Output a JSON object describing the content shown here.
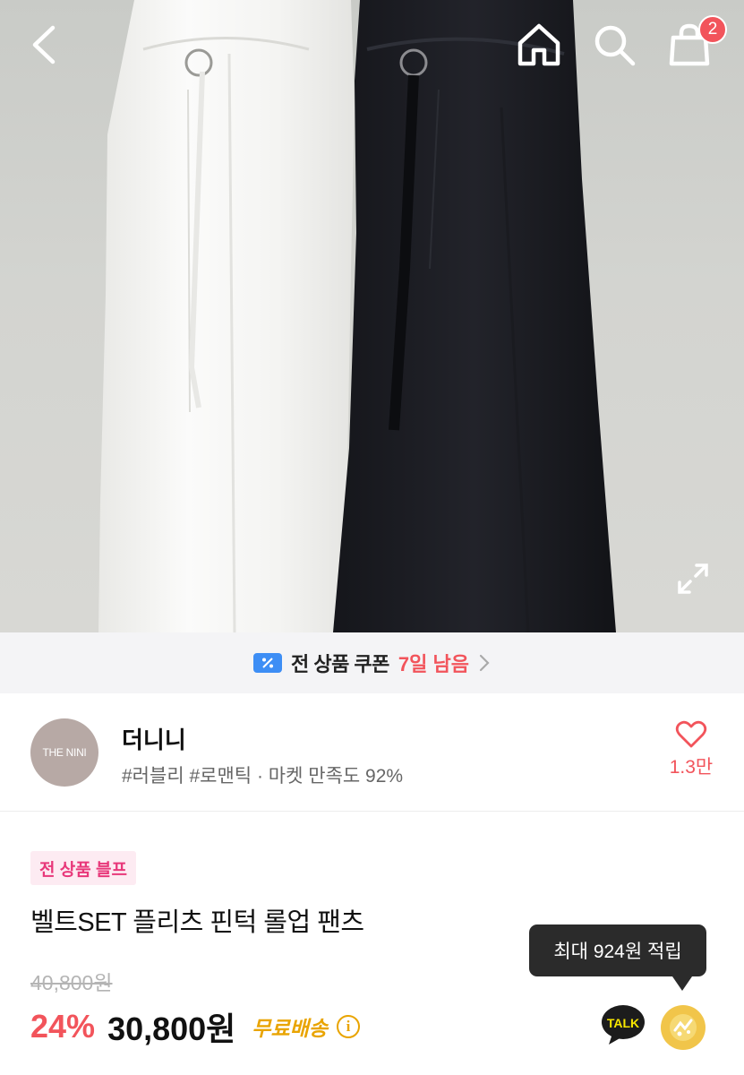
{
  "header": {
    "back_icon": "chevron-left-icon",
    "home_icon": "home-icon",
    "search_icon": "search-icon",
    "cart_icon": "shopping-bag-icon",
    "cart_count": "2",
    "expand_icon": "expand-icon"
  },
  "coupon_banner": {
    "icon": "coupon-icon",
    "text": "전 상품 쿠폰",
    "days_left": "7일 남음",
    "arrow_icon": "chevron-right-icon"
  },
  "store": {
    "logo_text": "THE NINI",
    "name": "더니니",
    "tags": "#러블리 #로맨틱 · 마켓 만족도 92%",
    "like_icon": "heart-outline-icon",
    "like_count": "1.3만"
  },
  "product": {
    "promo_badge": "전 상품 블프",
    "title": "벨트SET 플리츠 핀턱 롤업 팬츠",
    "original_price": "40,800원",
    "discount": "24%",
    "sale_price": "30,800원",
    "free_shipping": "무료배송",
    "info_icon": "info-icon"
  },
  "tooltip": {
    "text": "최대 924원 적립"
  },
  "actions": {
    "talk_label": "TALK",
    "talk_icon": "kakao-talk-icon",
    "reward_icon": "reward-coin-icon"
  },
  "colors": {
    "accent_red": "#f2545b",
    "pink_badge_text": "#e8387a",
    "shipping_yellow": "#e9a400",
    "coupon_blue": "#3d8ef5"
  }
}
